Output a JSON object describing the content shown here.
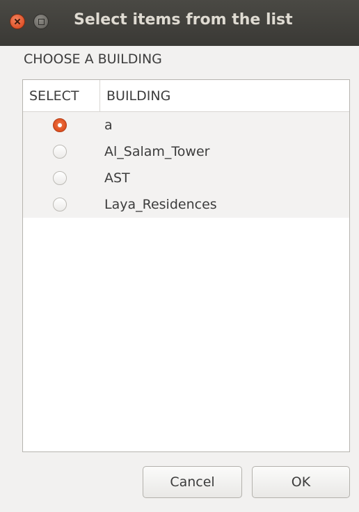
{
  "window": {
    "title": "Select items from the list"
  },
  "section": {
    "label": "CHOOSE A BUILDING"
  },
  "table": {
    "columns": [
      "SELECT",
      "BUILDING"
    ],
    "rows": [
      {
        "label": "a",
        "selected": true
      },
      {
        "label": "Al_Salam_Tower",
        "selected": false
      },
      {
        "label": "AST",
        "selected": false
      },
      {
        "label": "Laya_Residences",
        "selected": false
      }
    ]
  },
  "buttons": {
    "cancel": "Cancel",
    "ok": "OK"
  },
  "colors": {
    "accent": "#de4f1e",
    "titlebar": "#3c3b37"
  }
}
